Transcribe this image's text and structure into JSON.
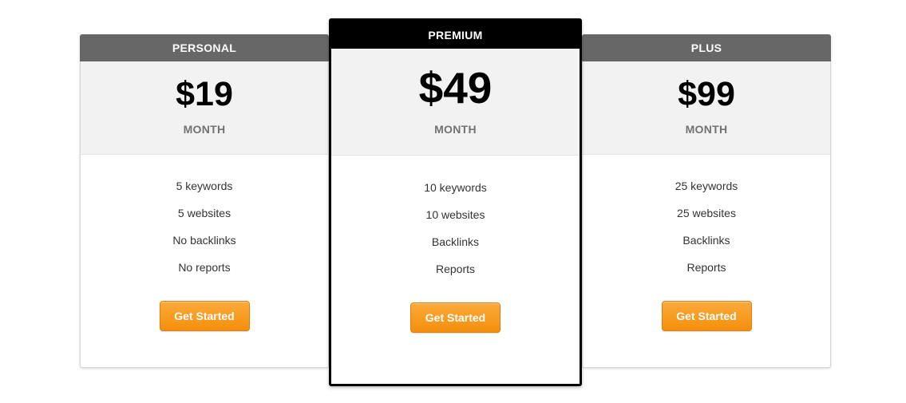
{
  "colors": {
    "side_header": "#676767",
    "featured_header": "#000000",
    "price_band": "#f2f2f2",
    "button": "#f7961a"
  },
  "plans": [
    {
      "name": "PERSONAL",
      "price": "$19",
      "period": "MONTH",
      "features": [
        "5 keywords",
        "5 websites",
        "No backlinks",
        "No reports"
      ],
      "button_label": "Get Started",
      "featured": false
    },
    {
      "name": "PREMIUM",
      "price": "$49",
      "period": "MONTH",
      "features": [
        "10 keywords",
        "10 websites",
        "Backlinks",
        "Reports"
      ],
      "button_label": "Get Started",
      "featured": true
    },
    {
      "name": "PLUS",
      "price": "$99",
      "period": "MONTH",
      "features": [
        "25 keywords",
        "25 websites",
        "Backlinks",
        "Reports"
      ],
      "button_label": "Get Started",
      "featured": false
    }
  ]
}
